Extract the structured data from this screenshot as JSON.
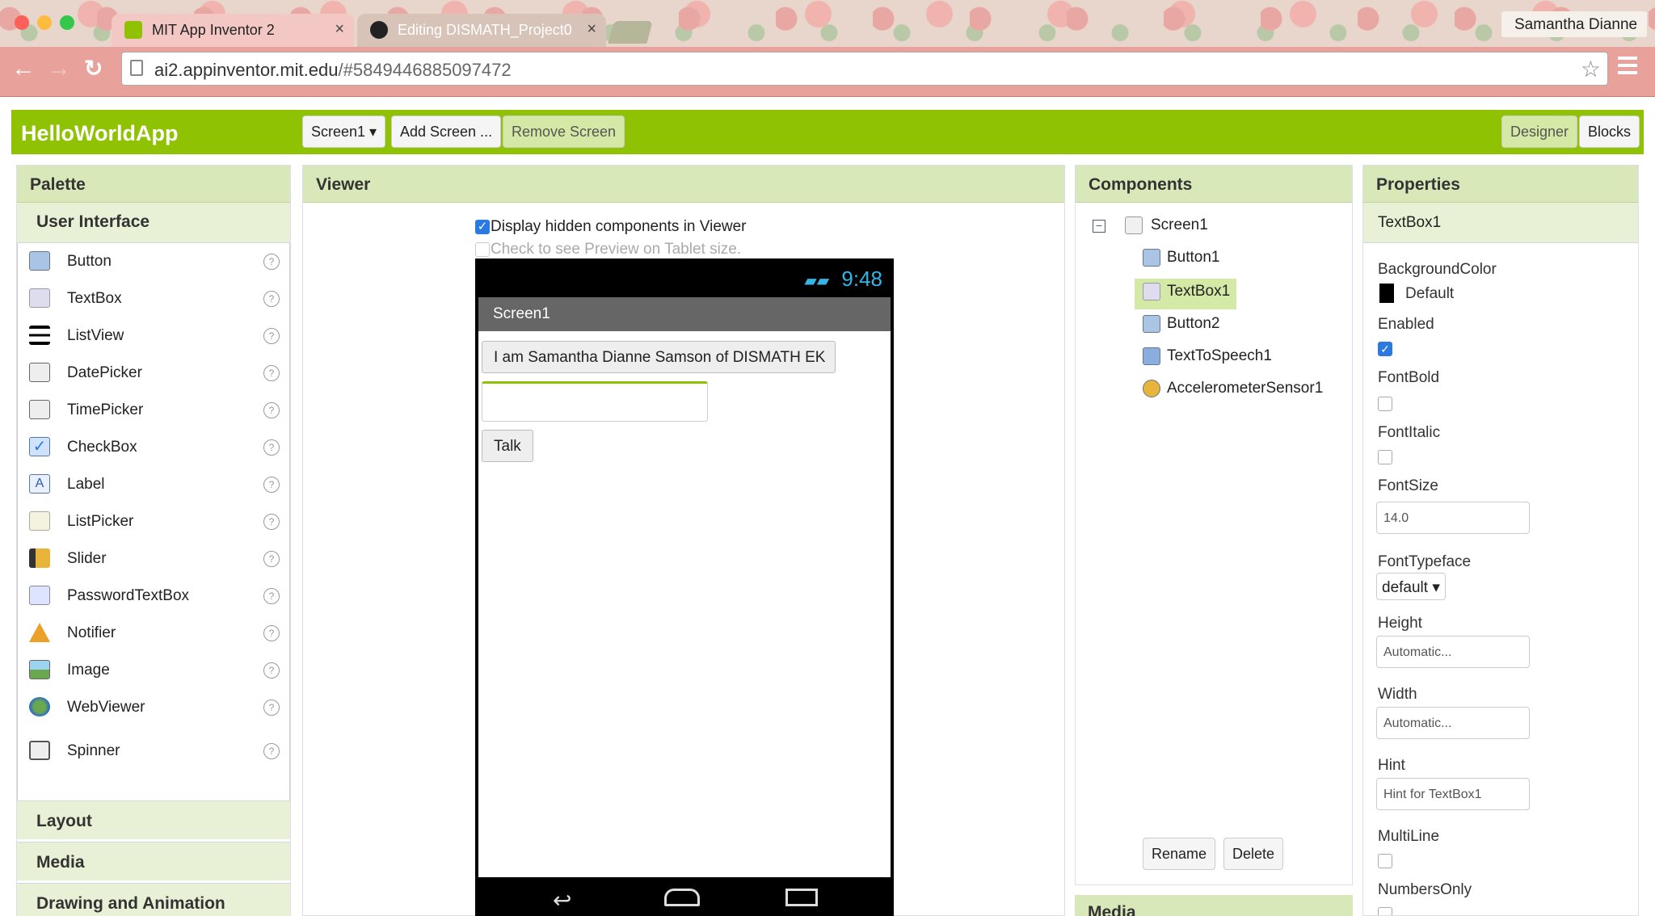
{
  "browser": {
    "tabs": [
      {
        "title": "MIT App Inventor 2",
        "close": "×"
      },
      {
        "title": "Editing DISMATH_Project0",
        "close": "×"
      }
    ],
    "url_host": "ai2.appinventor.mit.edu",
    "url_path": "/#5849446885097472",
    "user": "Samantha Dianne"
  },
  "app": {
    "name": "HelloWorldApp",
    "screen_select": "Screen1 ▾",
    "add_screen": "Add Screen ...",
    "remove_screen": "Remove Screen",
    "designer": "Designer",
    "blocks": "Blocks"
  },
  "palette": {
    "title": "Palette",
    "section": "User Interface",
    "items": [
      "Button",
      "TextBox",
      "ListView",
      "DatePicker",
      "TimePicker",
      "CheckBox",
      "Label",
      "ListPicker",
      "Slider",
      "PasswordTextBox",
      "Notifier",
      "Image",
      "WebViewer",
      "Spinner"
    ],
    "help": "?",
    "categories": [
      "Layout",
      "Media",
      "Drawing and Animation"
    ]
  },
  "viewer": {
    "title": "Viewer",
    "hidden_label": "Display hidden components in Viewer",
    "tablet_label": "Check to see Preview on Tablet size.",
    "time": "9:48",
    "screen_title": "Screen1",
    "label_text": "I am Samantha Dianne Samson of DISMATH EK",
    "talk_button": "Talk"
  },
  "components": {
    "title": "Components",
    "tree": [
      "Screen1",
      "Button1",
      "TextBox1",
      "Button2",
      "TextToSpeech1",
      "AccelerometerSensor1"
    ],
    "collapse": "−",
    "rename": "Rename",
    "delete": "Delete",
    "media_title": "Media"
  },
  "properties": {
    "title": "Properties",
    "component": "TextBox1",
    "background_color_label": "BackgroundColor",
    "background_color_value": "Default",
    "enabled_label": "Enabled",
    "enabled_check": "✓",
    "fontbold_label": "FontBold",
    "fontitalic_label": "FontItalic",
    "fontsize_label": "FontSize",
    "fontsize_value": "14.0",
    "typeface_label": "FontTypeface",
    "typeface_value": "default ▾",
    "height_label": "Height",
    "height_value": "Automatic...",
    "width_label": "Width",
    "width_value": "Automatic...",
    "hint_label": "Hint",
    "hint_value": "Hint for TextBox1",
    "multiline_label": "MultiLine",
    "numbersonly_label": "NumbersOnly"
  },
  "colors": {
    "accent": "#8fc202",
    "panel_header": "#d9e8b8",
    "checkbox": "#2a7ae2"
  }
}
